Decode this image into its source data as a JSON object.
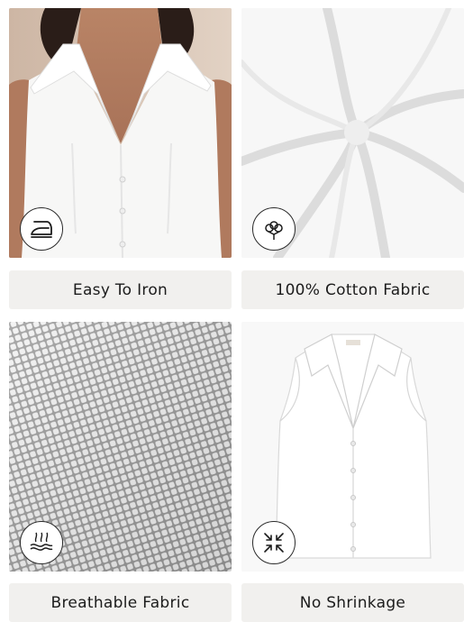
{
  "features": [
    {
      "label": "Easy To Iron",
      "icon": "iron-icon",
      "image": "model-wearing-sleeveless-white-shirt"
    },
    {
      "label": "100% Cotton Fabric",
      "icon": "cotton-icon",
      "image": "white-fabric-swirl"
    },
    {
      "label": "Breathable Fabric",
      "icon": "breathable-icon",
      "image": "fabric-weave-closeup"
    },
    {
      "label": "No Shrinkage",
      "icon": "no-shrinkage-icon",
      "image": "sleeveless-white-shirt-flatlay"
    }
  ]
}
